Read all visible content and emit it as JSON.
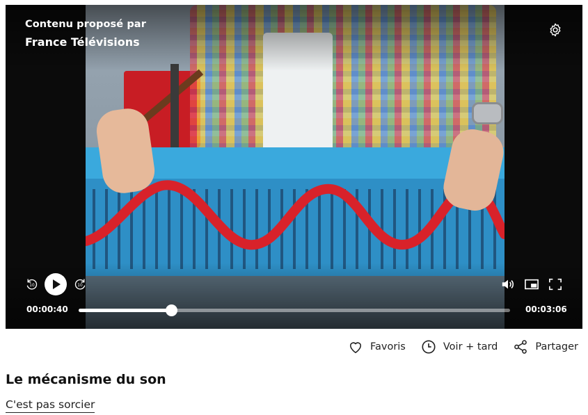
{
  "player": {
    "provider_label": "Contenu proposé par",
    "provider_name": "France Télévisions",
    "current_time": "00:00:40",
    "duration": "00:03:06",
    "progress": 0.2151,
    "skip_back_label": "10",
    "skip_forward_label": "10",
    "icons": {
      "settings": "gear-icon",
      "play": "play-icon",
      "rewind": "rewind-10-icon",
      "forward": "forward-10-icon",
      "volume": "volume-icon",
      "pip": "picture-in-picture-icon",
      "fullscreen": "fullscreen-icon"
    }
  },
  "actions": {
    "favorites_label": "Favoris",
    "watch_later_label": "Voir + tard",
    "share_label": "Partager"
  },
  "video": {
    "title": "Le mécanisme du son",
    "program": "C'est pas sorcier"
  },
  "colors": {
    "player_bg": "#0b0b0b",
    "text": "#111111",
    "progress_fill": "#ffffff"
  }
}
